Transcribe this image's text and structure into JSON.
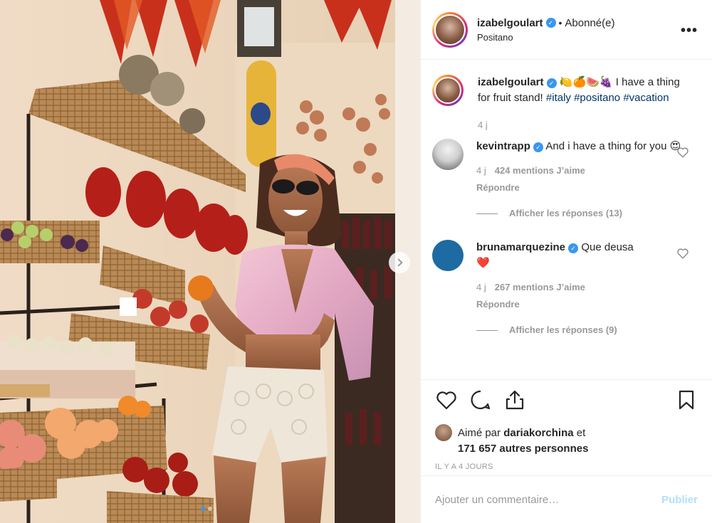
{
  "header": {
    "username": "izabelgoulart",
    "separator": "•",
    "follow_state": "Abonné(e)",
    "location": "Positano",
    "more_label": "•••"
  },
  "caption": {
    "username": "izabelgoulart",
    "emojis": "🍋🍊🍉🍇",
    "text": "I have a thing for fruit stand!",
    "hashtags": [
      "#italy",
      "#positano",
      "#vacation"
    ],
    "time": "4 j"
  },
  "comments": [
    {
      "username": "kevintrapp",
      "text": "And i have a thing for you",
      "emoji": "😍",
      "time": "4 j",
      "likes": "424 mentions J’aime",
      "reply_label": "Répondre",
      "view_replies": "Afficher les réponses (13)"
    },
    {
      "username": "brunamarquezine",
      "text": "Que deusa",
      "emoji": "❤️",
      "time": "4 j",
      "likes": "267 mentions J’aime",
      "reply_label": "Répondre",
      "view_replies": "Afficher les réponses (9)"
    }
  ],
  "likes": {
    "prefix": "Aimé par",
    "user": "dariakorchina",
    "connector": "et",
    "others": "171 657 autres personnes"
  },
  "timestamp": "IL Y A 4 JOURS",
  "comment_box": {
    "placeholder": "Ajouter un commentaire…",
    "publish_label": "Publier"
  },
  "carousel": {
    "current_index": 1,
    "total": 2
  },
  "colors": {
    "link_blue": "#003569",
    "verified_blue": "#3897f0",
    "publish_disabled": "#b2dffc",
    "muted": "#999999"
  },
  "icons": [
    "heart-icon",
    "comment-icon",
    "share-icon",
    "bookmark-icon",
    "verified-icon",
    "chevron-right-icon",
    "more-icon"
  ]
}
